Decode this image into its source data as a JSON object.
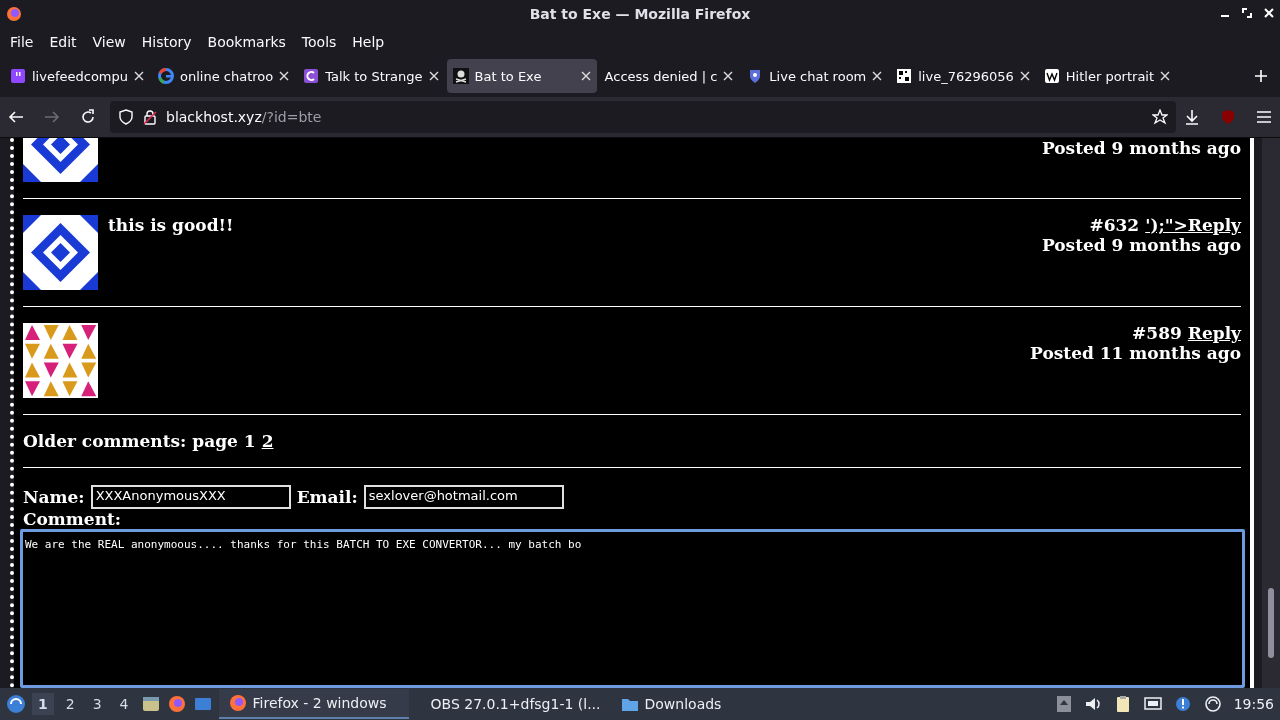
{
  "window": {
    "title": "Bat to Exe — Mozilla Firefox"
  },
  "menu": [
    "File",
    "Edit",
    "View",
    "History",
    "Bookmarks",
    "Tools",
    "Help"
  ],
  "tabs": [
    {
      "kind": "twitch",
      "label": "livefeedcompu",
      "selected": false
    },
    {
      "kind": "google",
      "label": "online chatroo",
      "selected": false
    },
    {
      "kind": "chat",
      "label": "Talk to Strange",
      "selected": false
    },
    {
      "kind": "pirate",
      "label": "Bat to Exe",
      "selected": true
    },
    {
      "kind": "none",
      "label": "Access denied | c",
      "selected": false
    },
    {
      "kind": "shield",
      "label": "Live chat room",
      "selected": false
    },
    {
      "kind": "grid",
      "label": "live_76296056",
      "selected": false
    },
    {
      "kind": "wiki",
      "label": "Hitler portrait",
      "selected": false
    }
  ],
  "address": {
    "domain": "blackhost.xyz",
    "path": "/?id=bte"
  },
  "comments": [
    {
      "kind": "diamond",
      "partial": true,
      "posted": "Posted 9 months ago"
    },
    {
      "kind": "diamond",
      "partial": false,
      "body": "this is good!!",
      "number": "#632",
      "reply": "');\">Reply",
      "posted": "Posted 9 months ago"
    },
    {
      "kind": "triangles",
      "partial": false,
      "number": "#589",
      "reply": "Reply",
      "posted": "Posted 11 months ago"
    }
  ],
  "pager": {
    "label": "Older comments: page 1",
    "link": "2"
  },
  "form": {
    "name_label": "Name:",
    "name": "XXXAnonymousXXX",
    "email_label": "Email:",
    "email": "sexlover@hotmail.com",
    "comment_label": "Comment:",
    "comment": "We are the REAL anonymoous.... thanks for this BATCH TO EXE CONVERTOR... my batch bo "
  },
  "taskbar": {
    "workspaces": [
      {
        "label": "1",
        "selected": true
      },
      {
        "label": "2",
        "selected": false
      },
      {
        "label": "3",
        "selected": false
      },
      {
        "label": "4",
        "selected": false
      }
    ],
    "tasks": [
      {
        "kind": "firefox",
        "label": "Firefox - 2 windows",
        "selected": true
      },
      {
        "kind": "obs",
        "label": "OBS 27.0.1+dfsg1-1 (l...",
        "selected": false
      },
      {
        "kind": "folder",
        "label": "Downloads",
        "selected": false
      }
    ],
    "clock": "19:56"
  }
}
